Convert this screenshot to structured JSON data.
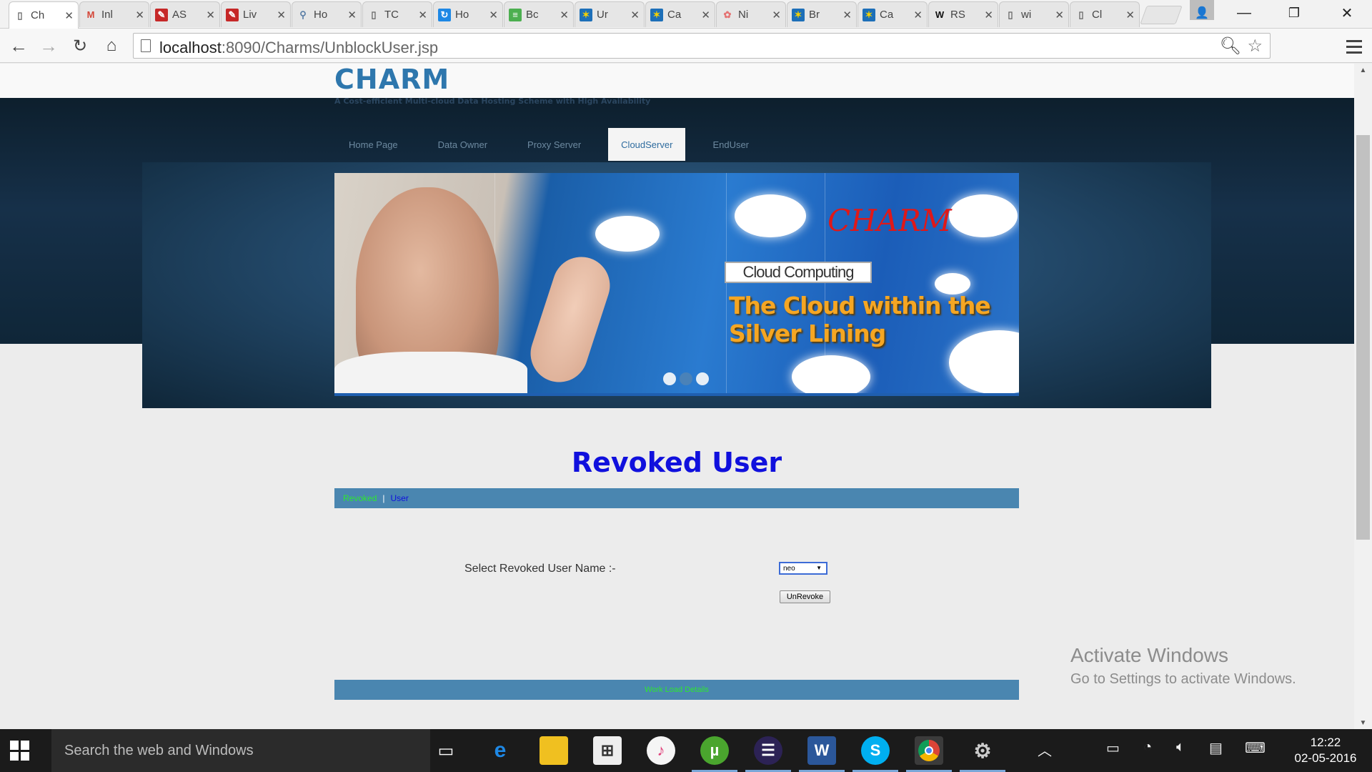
{
  "browser": {
    "tabs": [
      {
        "title": "Ch",
        "favicon": "page-icon",
        "active": true
      },
      {
        "title": "Inl",
        "favicon": "gmail-icon",
        "active": false
      },
      {
        "title": "AS",
        "favicon": "cms-icon",
        "active": false
      },
      {
        "title": "Liv",
        "favicon": "cms-icon",
        "active": false
      },
      {
        "title": "Ho",
        "favicon": "magnify-icon",
        "active": false
      },
      {
        "title": "TC",
        "favicon": "page-icon",
        "active": false
      },
      {
        "title": "Ho",
        "favicon": "refresh-bird-icon",
        "active": false
      },
      {
        "title": "Bc",
        "favicon": "book-icon",
        "active": false
      },
      {
        "title": "Ur",
        "favicon": "site-icon",
        "active": false
      },
      {
        "title": "Ca",
        "favicon": "site-icon",
        "active": false
      },
      {
        "title": "Ni",
        "favicon": "flower-icon",
        "active": false
      },
      {
        "title": "Br",
        "favicon": "site-icon",
        "active": false
      },
      {
        "title": "Ca",
        "favicon": "site-icon",
        "active": false
      },
      {
        "title": "RS",
        "favicon": "wikipedia-icon",
        "active": false
      },
      {
        "title": "wi",
        "favicon": "page-icon",
        "active": false
      },
      {
        "title": "Cl",
        "favicon": "page-icon",
        "active": false
      }
    ],
    "tab_close_glyph": "✕",
    "url_host": "localhost",
    "url_path": ":8090/Charms/UnblockUser.jsp",
    "window_controls": {
      "minimize": "—",
      "restore": "❐",
      "close": "✕"
    }
  },
  "site": {
    "logo": "CHARM",
    "tagline": "A Cost-efficient Multi-cloud Data Hosting Scheme with High Availability",
    "nav": [
      {
        "label": "Home Page",
        "active": false
      },
      {
        "label": "Data Owner",
        "active": false
      },
      {
        "label": "Proxy Server",
        "active": false
      },
      {
        "label": "CloudServer",
        "active": true
      },
      {
        "label": "EndUser",
        "active": false
      }
    ],
    "slide": {
      "brand": "CHARM",
      "badge": "Cloud Computing",
      "headline": "The Cloud within the Silver Lining",
      "dots_total": 3,
      "dots_active_index": 1
    }
  },
  "main": {
    "title": "Revoked User",
    "subnav_green": "Revoked",
    "subnav_sep": "|",
    "subnav_blue": "User",
    "form_label": "Select Revoked User Name :-",
    "selected_user": "neo",
    "button_label": "UnRevoke",
    "footer_text": "Work Load Details"
  },
  "watermark": {
    "line1": "Activate Windows",
    "line2": "Go to Settings to activate Windows."
  },
  "taskbar": {
    "search_placeholder": "Search the web and Windows",
    "time": "12:22",
    "date": "02-05-2016"
  },
  "colors": {
    "accent_blue": "#4a86b0",
    "title_blue": "#1010dd",
    "link_green": "#2ee82e",
    "logo_blue": "#2e77ad"
  }
}
